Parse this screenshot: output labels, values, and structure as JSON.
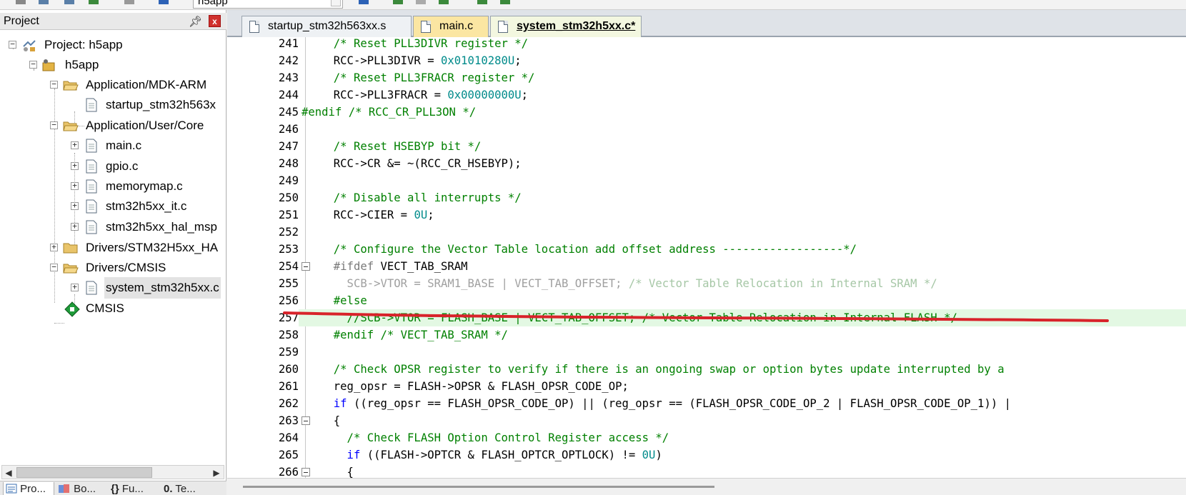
{
  "toolbar": {
    "target_combo": "h5app"
  },
  "project_panel": {
    "title": "Project",
    "close_label": "x",
    "tree": {
      "root": "Project: h5app",
      "target": "h5app",
      "groups": [
        {
          "label": "Application/MDK-ARM",
          "files": [
            "startup_stm32h563x"
          ]
        },
        {
          "label": "Application/User/Core",
          "files": [
            "main.c",
            "gpio.c",
            "memorymap.c",
            "stm32h5xx_it.c",
            "stm32h5xx_hal_msp"
          ]
        },
        {
          "label": "Drivers/STM32H5xx_HA",
          "files": []
        },
        {
          "label": "Drivers/CMSIS",
          "files": [
            "system_stm32h5xx.c"
          ]
        }
      ],
      "cmsis": "CMSIS"
    },
    "bottom_tabs": [
      "Pro...",
      "Bo...",
      "Fu...",
      "Te..."
    ]
  },
  "editor": {
    "tabs": [
      {
        "label": "startup_stm32h563xx.s",
        "active": false
      },
      {
        "label": "main.c",
        "active": false
      },
      {
        "label": "system_stm32h5xx.c*",
        "active": true
      }
    ],
    "lines": [
      {
        "n": "241",
        "segs": [
          [
            "c-com",
            "  /* Reset PLL3DIVR register */"
          ]
        ]
      },
      {
        "n": "242",
        "segs": [
          [
            "c-txt",
            "  RCC->PLL3DIVR = "
          ],
          [
            "c-num",
            "0x01010280U"
          ],
          [
            "c-txt",
            ";"
          ]
        ]
      },
      {
        "n": "243",
        "segs": [
          [
            "c-com",
            "  /* Reset PLL3FRACR register */"
          ]
        ]
      },
      {
        "n": "244",
        "segs": [
          [
            "c-txt",
            "  RCC->PLL3FRACR = "
          ],
          [
            "c-num",
            "0x00000000U"
          ],
          [
            "c-txt",
            ";"
          ]
        ]
      },
      {
        "n": "245",
        "segs": [
          [
            "c-com",
            "#endif /* RCC_CR_PLL3ON */"
          ]
        ]
      },
      {
        "n": "246",
        "segs": []
      },
      {
        "n": "247",
        "segs": [
          [
            "c-com",
            "  /* Reset HSEBYP bit */"
          ]
        ]
      },
      {
        "n": "248",
        "segs": [
          [
            "c-txt",
            "  RCC->CR &= ~(RCC_CR_HSEBYP);"
          ]
        ]
      },
      {
        "n": "249",
        "segs": []
      },
      {
        "n": "250",
        "segs": [
          [
            "c-com",
            "  /* Disable all interrupts */"
          ]
        ]
      },
      {
        "n": "251",
        "segs": [
          [
            "c-txt",
            "  RCC->CIER = "
          ],
          [
            "c-num",
            "0U"
          ],
          [
            "c-txt",
            ";"
          ]
        ]
      },
      {
        "n": "252",
        "segs": []
      },
      {
        "n": "253",
        "segs": [
          [
            "c-com",
            "  /* Configure the Vector Table location add offset address ------------------*/"
          ]
        ]
      },
      {
        "n": "254",
        "segs": [
          [
            "c-pp",
            "  #ifdef "
          ],
          [
            "c-txt",
            "VECT_TAB_SRAM"
          ]
        ]
      },
      {
        "n": "255",
        "segs": [
          [
            "c-gray",
            "    SCB->VTOR = SRAM1_BASE | VECT_TAB_OFFSET; "
          ],
          [
            "c-gray-com",
            "/* Vector Table Relocation in Internal SRAM */"
          ]
        ]
      },
      {
        "n": "256",
        "segs": [
          [
            "c-com",
            "  #else"
          ]
        ]
      },
      {
        "n": "257",
        "segs": [
          [
            "c-com",
            "    //SCB->VTOR = FLASH_BASE | VECT_TAB_OFFSET; /* Vector Table Relocation in Internal FLASH */"
          ]
        ]
      },
      {
        "n": "258",
        "segs": [
          [
            "c-com",
            "  #endif /* VECT_TAB_SRAM */"
          ]
        ]
      },
      {
        "n": "259",
        "segs": []
      },
      {
        "n": "260",
        "segs": [
          [
            "c-com",
            "  /* Check OPSR register to verify if there is an ongoing swap or option bytes update interrupted by a"
          ]
        ]
      },
      {
        "n": "261",
        "segs": [
          [
            "c-txt",
            "  reg_opsr = FLASH->OPSR & FLASH_OPSR_CODE_OP;"
          ]
        ]
      },
      {
        "n": "262",
        "segs": [
          [
            "c-kw",
            "  if"
          ],
          [
            "c-txt",
            " ((reg_opsr == FLASH_OPSR_CODE_OP) || (reg_opsr == (FLASH_OPSR_CODE_OP_2 | FLASH_OPSR_CODE_OP_1)) |"
          ]
        ]
      },
      {
        "n": "263",
        "segs": [
          [
            "c-txt",
            "  {"
          ]
        ]
      },
      {
        "n": "264",
        "segs": [
          [
            "c-com",
            "    /* Check FLASH Option Control Register access */"
          ]
        ]
      },
      {
        "n": "265",
        "segs": [
          [
            "c-kw",
            "    if"
          ],
          [
            "c-txt",
            " ((FLASH->OPTCR & FLASH_OPTCR_OPTLOCK) != "
          ],
          [
            "c-num",
            "0U"
          ],
          [
            "c-txt",
            ")"
          ]
        ]
      },
      {
        "n": "266",
        "segs": [
          [
            "c-txt",
            "    {"
          ]
        ]
      }
    ],
    "highlight_line": "257"
  },
  "colors": {
    "annotation_red": "#d8232a",
    "highlight_bg": "#e3f8e3",
    "active_tab": "#f3f7e0",
    "main_tab": "#fbe6a2"
  }
}
